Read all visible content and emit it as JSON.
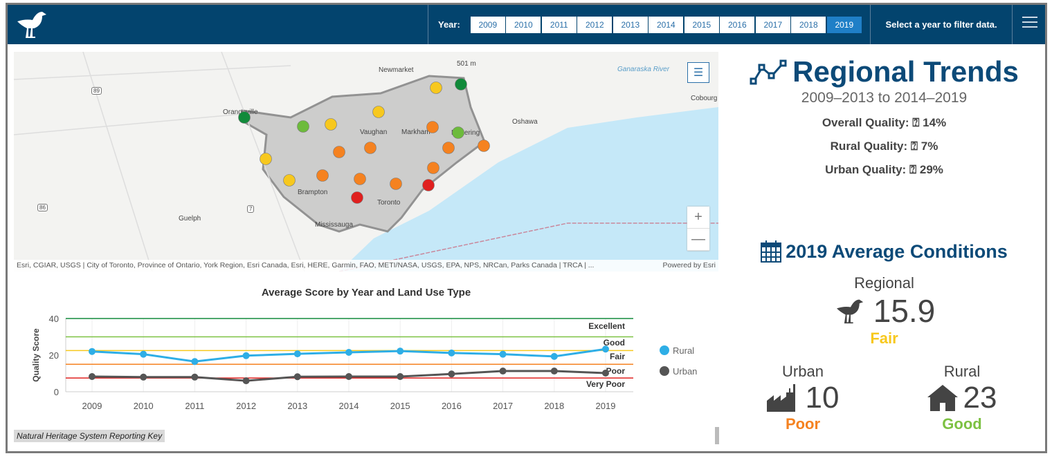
{
  "header": {
    "year_label": "Year:",
    "years": [
      "2009",
      "2010",
      "2011",
      "2012",
      "2013",
      "2014",
      "2015",
      "2016",
      "2017",
      "2018",
      "2019"
    ],
    "selected_year": "2019",
    "hint": "Select a year to filter data.",
    "logo_icon": "bird-icon",
    "menu_icon": "hamburger-icon"
  },
  "map": {
    "places": [
      "Newmarket",
      "Orangeville",
      "Vaughan",
      "Markham",
      "Pickering",
      "Oshawa",
      "Cobourg",
      "Brampton",
      "Toronto",
      "Mississauga",
      "Guelph",
      "501 m",
      "Ganaraska River",
      "89",
      "86",
      "7"
    ],
    "attribution": "Esri, CGIAR, USGS | City of Toronto, Province of Ontario, York Region, Esri Canada, Esri, HERE, Garmin, FAO, METI/NASA, USGS, EPA, NPS, NRCan, Parks Canada | TRCA | ...",
    "powered": "Powered by Esri",
    "zoom_in": "+",
    "zoom_out": "—",
    "condition_colors": {
      "Excellent": "#118a3a",
      "Good": "#6dbb3c",
      "Fair": "#f7c81e",
      "Poor": "#f58220",
      "Very Poor": "#e0201f"
    }
  },
  "chart_data": {
    "type": "line",
    "title": "Average Score by Year and Land Use Type",
    "ylabel": "Quality Score",
    "xlabel": "",
    "ylim": [
      0,
      40
    ],
    "yticks": [
      0,
      20,
      40
    ],
    "categories": [
      "2009",
      "2010",
      "2011",
      "2012",
      "2013",
      "2014",
      "2015",
      "2016",
      "2017",
      "2018",
      "2019"
    ],
    "series": [
      {
        "name": "Rural",
        "color": "#2eaee6",
        "values": [
          22,
          20.5,
          16.5,
          19.7,
          20.7,
          21.5,
          22.2,
          21.2,
          20.5,
          19.3,
          23.3
        ]
      },
      {
        "name": "Urban",
        "color": "#555555",
        "values": [
          8.3,
          8,
          8,
          6,
          8.2,
          8.3,
          8.3,
          9.7,
          11.3,
          11.3,
          10.2
        ]
      }
    ],
    "thresholds": [
      {
        "value": 40,
        "color": "#118a3a"
      },
      {
        "value": 30,
        "color": "#7cc142"
      },
      {
        "value": 22.5,
        "color": "#f7c81e"
      },
      {
        "value": 15,
        "color": "#f58220"
      },
      {
        "value": 7.5,
        "color": "#e0201f"
      }
    ],
    "bands": [
      "Excellent",
      "Good",
      "Fair",
      "Poor",
      "Very Poor"
    ],
    "legend": "right"
  },
  "footer": {
    "key": "Natural Heritage System Reporting Key"
  },
  "trends": {
    "title": "Regional Trends",
    "period": "2009–2013 to 2014–2019",
    "overall": "Overall Quality: ⍰ 14%",
    "rural": "Rural Quality: ⍰ 7%",
    "urban": "Urban Quality: ⍰ 29%"
  },
  "conditions": {
    "title": "2019 Average Conditions",
    "regional": {
      "label": "Regional",
      "value": "15.9",
      "rating": "Fair",
      "color": "#f7c81e"
    },
    "urban": {
      "label": "Urban",
      "value": "10",
      "rating": "Poor",
      "color": "#f58220"
    },
    "rural": {
      "label": "Rural",
      "value": "23",
      "rating": "Good",
      "color": "#7cc142"
    }
  }
}
